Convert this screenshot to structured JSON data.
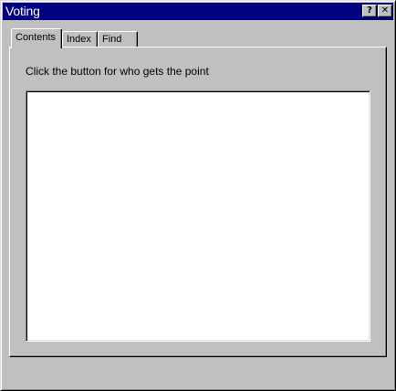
{
  "window": {
    "title": "Voting",
    "help_button": "?",
    "close_button": "✕"
  },
  "tabs": [
    {
      "label": "Contents",
      "selected": true
    },
    {
      "label": "Index",
      "selected": false
    },
    {
      "label": "Find",
      "selected": false
    }
  ],
  "panel": {
    "instruction": "Click the button for who gets the point"
  }
}
